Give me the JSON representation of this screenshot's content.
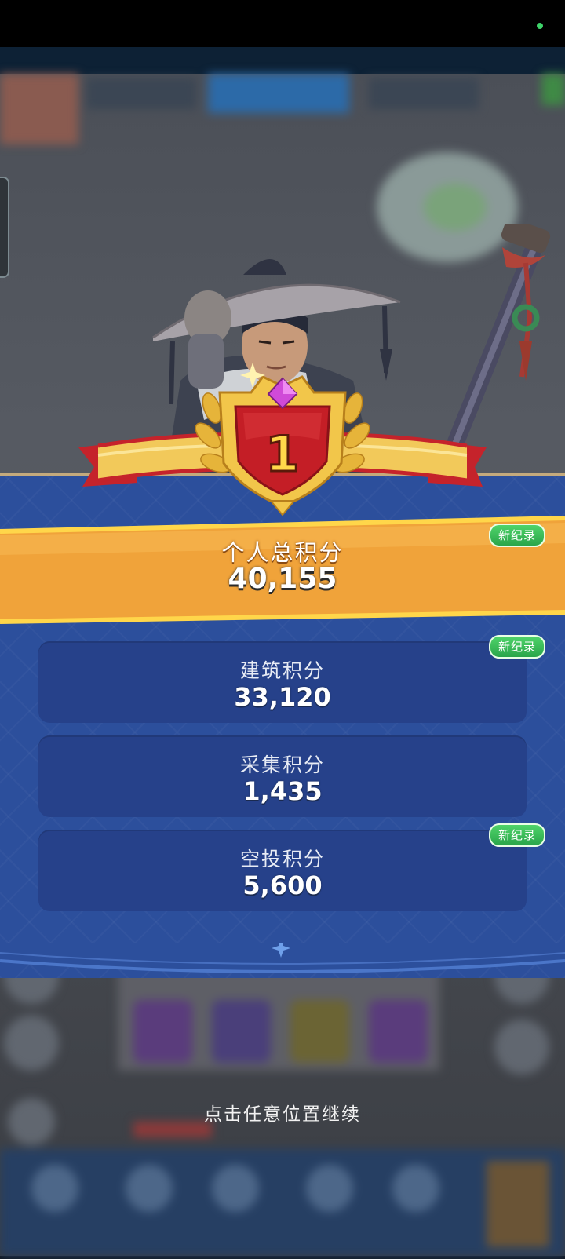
{
  "rank": "1",
  "total": {
    "label": "个人总积分",
    "value": "40,155",
    "badge": "新纪录"
  },
  "scores": [
    {
      "label": "建筑积分",
      "value": "33,120",
      "badge": "新纪录"
    },
    {
      "label": "采集积分",
      "value": "1,435",
      "badge": ""
    },
    {
      "label": "空投积分",
      "value": "5,600",
      "badge": "新纪录"
    }
  ],
  "continue_hint": "点击任意位置继续",
  "colors": {
    "panel_blue": "#2c4f9c",
    "band_orange": "#f0a33a",
    "badge_green": "#3cc05a",
    "gold": "#f3c84a"
  }
}
